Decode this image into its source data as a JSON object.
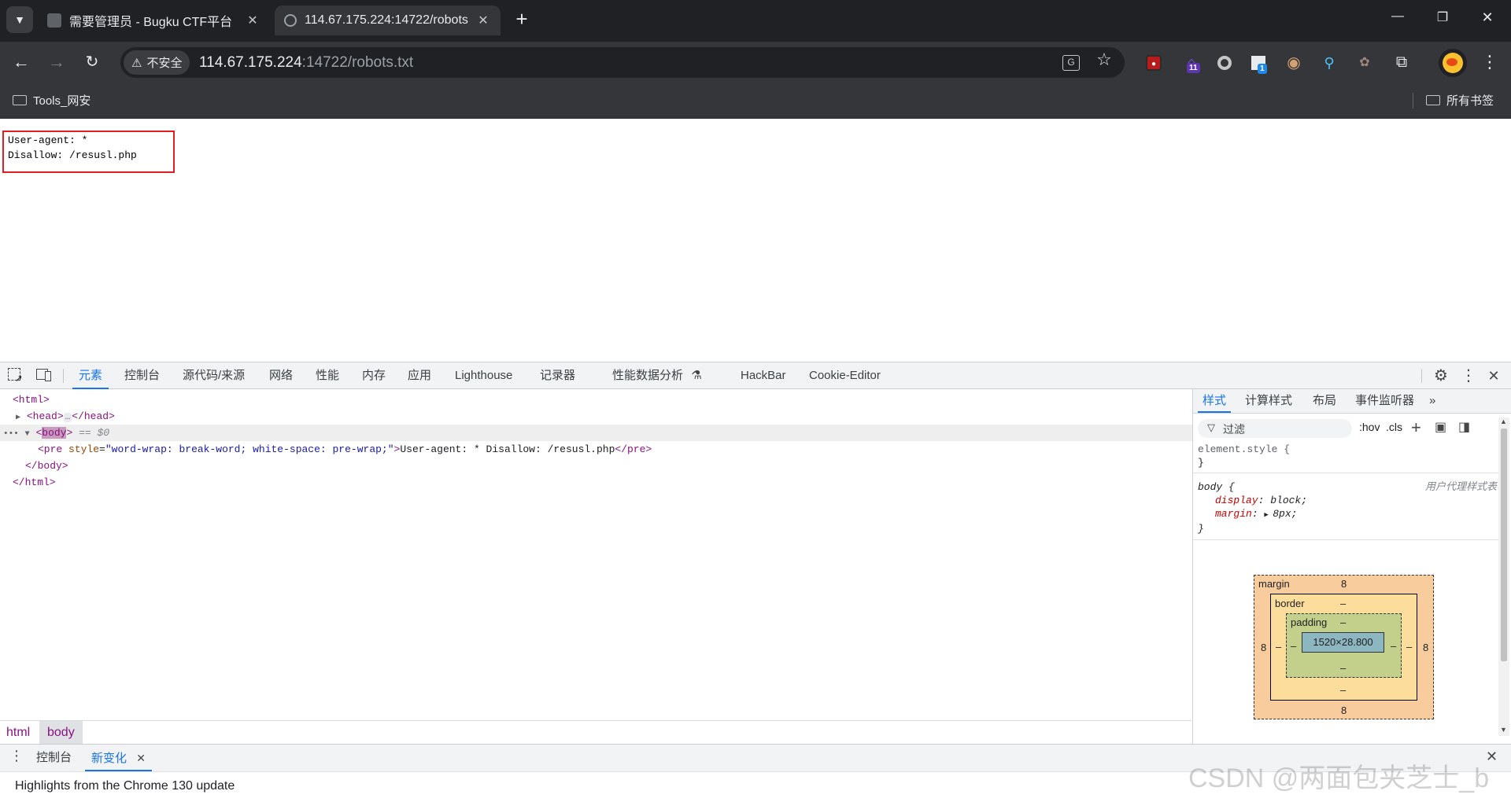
{
  "tabs": [
    {
      "title": "需要管理员 - Bugku CTF平台",
      "active": false
    },
    {
      "title": "114.67.175.224:14722/robots",
      "active": true
    }
  ],
  "window_controls": {
    "minimize": "—",
    "restore": "❐",
    "close": "✕"
  },
  "address_bar": {
    "security_label": "不安全",
    "host": "114.67.175.224",
    "path": ":14722/robots.txt"
  },
  "extensions": [
    {
      "name": "red-extension-icon",
      "glyph": "●",
      "bg": "#b71c1c"
    },
    {
      "name": "hat-extension-icon",
      "glyph": "11",
      "bg": "#5e35b1"
    },
    {
      "name": "circle-extension-icon",
      "glyph": "◯",
      "bg": "#35363a"
    },
    {
      "name": "qr-extension-icon",
      "glyph": "1",
      "bg": "#1e88e5"
    },
    {
      "name": "cookie-extension-icon",
      "glyph": "◉",
      "bg": "#35363a"
    },
    {
      "name": "pin-extension-icon",
      "glyph": "⚲",
      "bg": "#35363a"
    },
    {
      "name": "badge-extension-icon",
      "glyph": "✿",
      "bg": "#35363a"
    }
  ],
  "bookmarks": {
    "folder": "Tools_网安",
    "all": "所有书签"
  },
  "page": {
    "text": "User-agent: *\nDisallow: /resusl.php"
  },
  "devtools": {
    "tabs": [
      "元素",
      "控制台",
      "源代码/来源",
      "网络",
      "性能",
      "内存",
      "应用",
      "Lighthouse",
      "记录器",
      "性能数据分析",
      "HackBar",
      "Cookie-Editor"
    ],
    "active_tab": "元素",
    "dom": {
      "html_open": "<html>",
      "head_open": "<head>",
      "ellipsis": "…",
      "head_close": "</head>",
      "body_open_lt": "<",
      "body_tagname": "body",
      "body_open_gt": ">",
      "selected_marker": "== $0",
      "pre_open": "<pre",
      "pre_attr_name": "style",
      "pre_attr_value": "\"word-wrap: break-word; white-space: pre-wrap;\"",
      "pre_gt": ">",
      "pre_text": "User-agent: * Disallow: /resusl.php",
      "pre_close": "</pre>",
      "body_close": "</body>",
      "html_close": "</html>"
    },
    "breadcrumbs": [
      "html",
      "body"
    ],
    "sidebar": {
      "tabs": [
        "样式",
        "计算样式",
        "布局",
        "事件监听器"
      ],
      "active_tab": "样式",
      "filter_placeholder": "过滤",
      "hov": ":hov",
      "cls": ".cls",
      "element_style_selector": "element.style {",
      "close_brace": "}",
      "body_rule_selector": "body {",
      "body_rule_origin": "用户代理样式表",
      "declarations": [
        {
          "prop": "display",
          "value": "block;"
        },
        {
          "prop": "margin",
          "value": "8px;"
        }
      ],
      "box_model": {
        "margin_label": "margin",
        "margin_top": "8",
        "margin_bottom": "8",
        "margin_left": "8",
        "margin_right": "8",
        "border_label": "border",
        "border_value": "–",
        "padding_label": "padding",
        "padding_value": "–",
        "content": "1520×28.800"
      }
    },
    "drawer": {
      "tabs": [
        "控制台",
        "新变化"
      ],
      "active_tab": "新变化",
      "content": "Highlights from the Chrome 130 update"
    }
  },
  "watermark": "CSDN @两面包夹芝士_b"
}
